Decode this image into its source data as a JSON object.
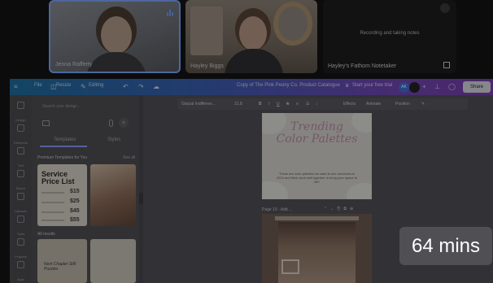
{
  "meeting": {
    "participants": [
      {
        "name": "Jenna Rafferty",
        "speaking": true
      },
      {
        "name": "Hayley Biggs",
        "speaking": false
      },
      {
        "name": "Hayley's Fathom Notetaker",
        "status": "Recording and taking notes"
      }
    ]
  },
  "editor": {
    "topbar": {
      "file": "File",
      "resize": "Resize",
      "editing": "Editing",
      "doc_title": "Copy of The Pink Peony Co.  Product Catalogue",
      "trial": "Start your free trial",
      "avatar_initials": "AK",
      "share": "Share"
    },
    "leftnav": [
      "Design",
      "Elements",
      "Text",
      "Brand",
      "Uploads",
      "Tools",
      "Projects",
      "Apps"
    ],
    "panel": {
      "search_placeholder": "Search your design...",
      "tabs": [
        "Templates",
        "Styles"
      ],
      "premium_heading": "Premium Templates for You",
      "see_all": "See all",
      "all_results": "All results",
      "card1": {
        "title_line1": "Service",
        "title_line2": "Price List",
        "prices": [
          "$15",
          "$25",
          "$45",
          "$55"
        ]
      },
      "card3_text": "Next Chapter Still Puzzles"
    },
    "toolbar": {
      "font": "Glacial Indifferen...",
      "size": "21.8",
      "effects": "Effects",
      "animate": "Animate",
      "position": "Position"
    },
    "page1": {
      "title_line1": "Trending",
      "title_line2": "Color Palettes",
      "body": "These are color palettes we want to see ourselves in 2023 and think work well together to bring your space to life!"
    },
    "page2_label": "Page 10 - Add ..."
  },
  "duration_badge": "64 mins",
  "colors": {
    "speaking_border": "#7da7ff",
    "topbar_start": "#1f6fa0",
    "topbar_end": "#7a3fb0",
    "title_pink": "#b98ea2"
  }
}
